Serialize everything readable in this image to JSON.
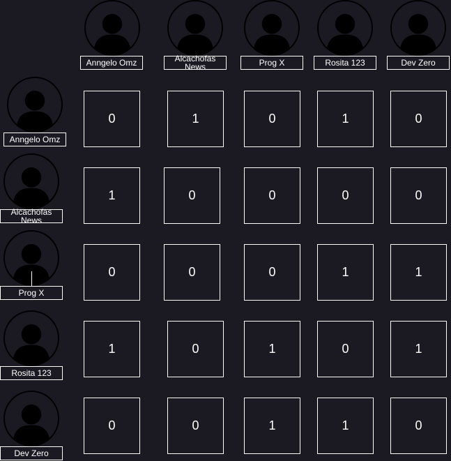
{
  "users": [
    "Anngelo Omz",
    "Alcachofas News",
    "Prog X",
    "Rosita 123",
    "Dev Zero"
  ],
  "matrix": [
    [
      "0",
      "1",
      "0",
      "1",
      "0"
    ],
    [
      "1",
      "0",
      "0",
      "0",
      "0"
    ],
    [
      "0",
      "0",
      "0",
      "1",
      "1"
    ],
    [
      "1",
      "0",
      "1",
      "0",
      "1"
    ],
    [
      "0",
      "0",
      "1",
      "1",
      "0"
    ]
  ],
  "colors": {
    "background": "#1b1a22",
    "border": "#ffffff",
    "avatar_silhouette": "#000000"
  },
  "icons": {
    "avatar": "user-silhouette-icon"
  }
}
